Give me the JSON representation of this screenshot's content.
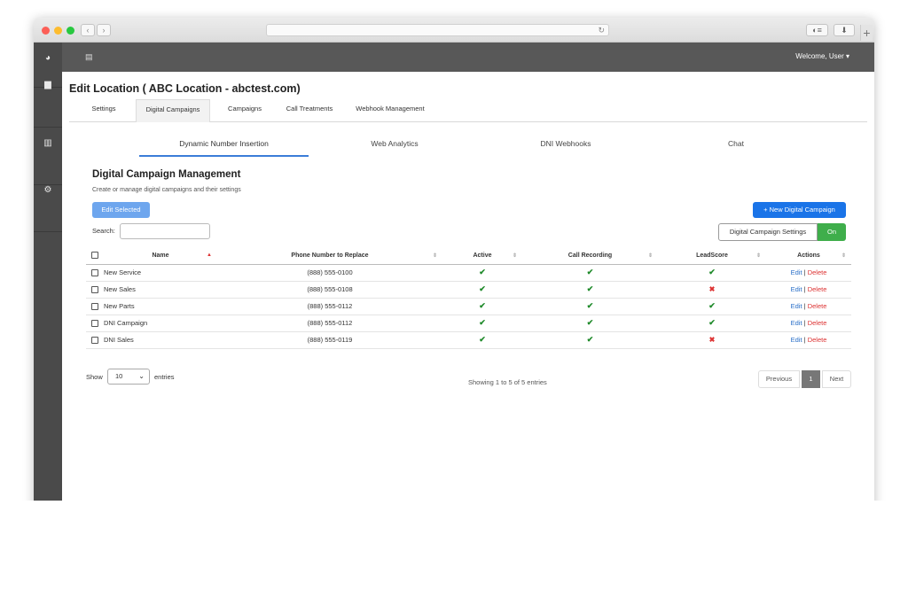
{
  "topbar": {
    "welcome": "Welcome, User ▾"
  },
  "page": {
    "title": "Edit Location ( ABC Location - abctest.com)"
  },
  "tabs": [
    {
      "label": "Settings"
    },
    {
      "label": "Digital Campaigns"
    },
    {
      "label": "Campaigns"
    },
    {
      "label": "Call Treatments"
    },
    {
      "label": "Webhook Management"
    }
  ],
  "subtabs": [
    {
      "label": "Dynamic Number Insertion"
    },
    {
      "label": "Web Analytics"
    },
    {
      "label": "DNI Webhooks"
    },
    {
      "label": "Chat"
    }
  ],
  "section": {
    "title": "Digital Campaign Management",
    "subtitle": "Create or manage digital campaigns and their settings",
    "edit_selected": "Edit Selected",
    "new_campaign": "+ New Digital Campaign",
    "search_label": "Search:",
    "settings_label": "Digital Campaign Settings",
    "settings_state": "On"
  },
  "table": {
    "headers": [
      "Name",
      "Phone Number to Replace",
      "Active",
      "Call Recording",
      "LeadScore",
      "Actions"
    ],
    "rows": [
      {
        "name": "New Service",
        "phone": "(888) 555-0100",
        "active": "✔",
        "recording": "✔",
        "leadscore": "✔",
        "edit": "Edit",
        "bar": "|",
        "delete": "Delete"
      },
      {
        "name": "New Sales",
        "phone": "(888) 555-0108",
        "active": "✔",
        "recording": "✔",
        "leadscore": "✖",
        "edit": "Edit",
        "bar": "|",
        "delete": "Delete"
      },
      {
        "name": "New Parts",
        "phone": "(888) 555-0112",
        "active": "✔",
        "recording": "✔",
        "leadscore": "✔",
        "edit": "Edit",
        "bar": "|",
        "delete": "Delete"
      },
      {
        "name": "DNI Campaign",
        "phone": "(888) 555-0112",
        "active": "✔",
        "recording": "✔",
        "leadscore": "✔",
        "edit": "Edit",
        "bar": "|",
        "delete": "Delete"
      },
      {
        "name": "DNI Sales",
        "phone": "(888) 555-0119",
        "active": "✔",
        "recording": "✔",
        "leadscore": "✖",
        "edit": "Edit",
        "bar": "|",
        "delete": "Delete"
      }
    ]
  },
  "footer": {
    "show": "Show",
    "page_size": "10",
    "entries": "entries",
    "showing": "Showing 1 to 5 of 5 entries",
    "previous": "Previous",
    "current_page": "1",
    "next": "Next"
  },
  "colors": {
    "accent": "#1a74e8",
    "success": "#3fae4b",
    "danger": "#dd3333"
  },
  "icons": [
    "dashboard-icon",
    "chat-icon",
    "chart-icon",
    "cogs-icon",
    "menu-icon"
  ]
}
